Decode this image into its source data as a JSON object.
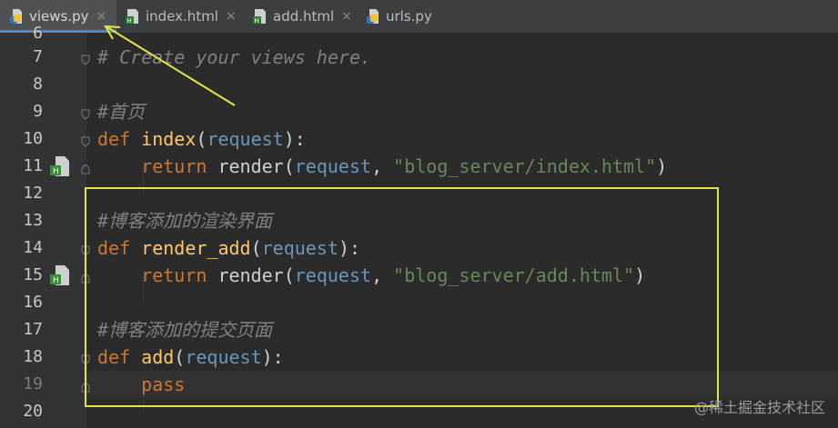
{
  "tabs": [
    {
      "label": "views.py",
      "active": true,
      "icon": "python-icon"
    },
    {
      "label": "index.html",
      "active": false,
      "icon": "html-icon"
    },
    {
      "label": "add.html",
      "active": false,
      "icon": "html-icon"
    },
    {
      "label": "urls.py",
      "active": false,
      "icon": "python-icon"
    }
  ],
  "tab_close_glyph": "×",
  "lines": [
    {
      "num": "6"
    },
    {
      "num": "7",
      "comment": "# Create your views here."
    },
    {
      "num": "8"
    },
    {
      "num": "9",
      "comment": "#首页"
    },
    {
      "num": "10",
      "kw": "def",
      "fn": "index",
      "param": "request",
      "tail": "):"
    },
    {
      "num": "11",
      "kw": "return",
      "call": "render",
      "param": "request",
      "str": "\"blog_server/index.html\"",
      "tail": ")"
    },
    {
      "num": "12"
    },
    {
      "num": "13",
      "comment": "#博客添加的渲染界面"
    },
    {
      "num": "14",
      "kw": "def",
      "fn": "render_add",
      "param": "request",
      "tail": "):"
    },
    {
      "num": "15",
      "kw": "return",
      "call": "render",
      "param": "request",
      "str": "\"blog_server/add.html\"",
      "tail": ")"
    },
    {
      "num": "16"
    },
    {
      "num": "17",
      "comment": "#博客添加的提交页面"
    },
    {
      "num": "18",
      "kw": "def",
      "fn": "add",
      "param": "request",
      "tail": "):"
    },
    {
      "num": "19",
      "kw": "pass"
    },
    {
      "num": "20"
    }
  ],
  "watermark": "@稀土掘金技术社区",
  "colors": {
    "annotation": "#e4e44a",
    "html_marker": "#3a8c3a"
  }
}
